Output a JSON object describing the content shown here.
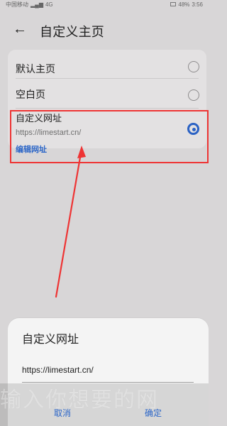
{
  "status_bar": {
    "carrier": "中国移动",
    "signal_meta": "4G",
    "battery": "48%",
    "time": "3:56"
  },
  "header": {
    "title": "自定义主页"
  },
  "options": {
    "default": {
      "label": "默认主页"
    },
    "blank": {
      "label": "空白页"
    },
    "custom": {
      "label": "自定义网址",
      "url": "https://limestart.cn/",
      "edit_label": "编辑网址"
    }
  },
  "dialog": {
    "title": "自定义网址",
    "input_value": "https://limestart.cn/",
    "cancel_label": "取消",
    "confirm_label": "确定"
  },
  "overlay": {
    "subtitle": "输入你想要的网"
  },
  "colors": {
    "accent": "#2b62c4",
    "highlight": "#ee3434",
    "background": "#d8d6d7"
  }
}
